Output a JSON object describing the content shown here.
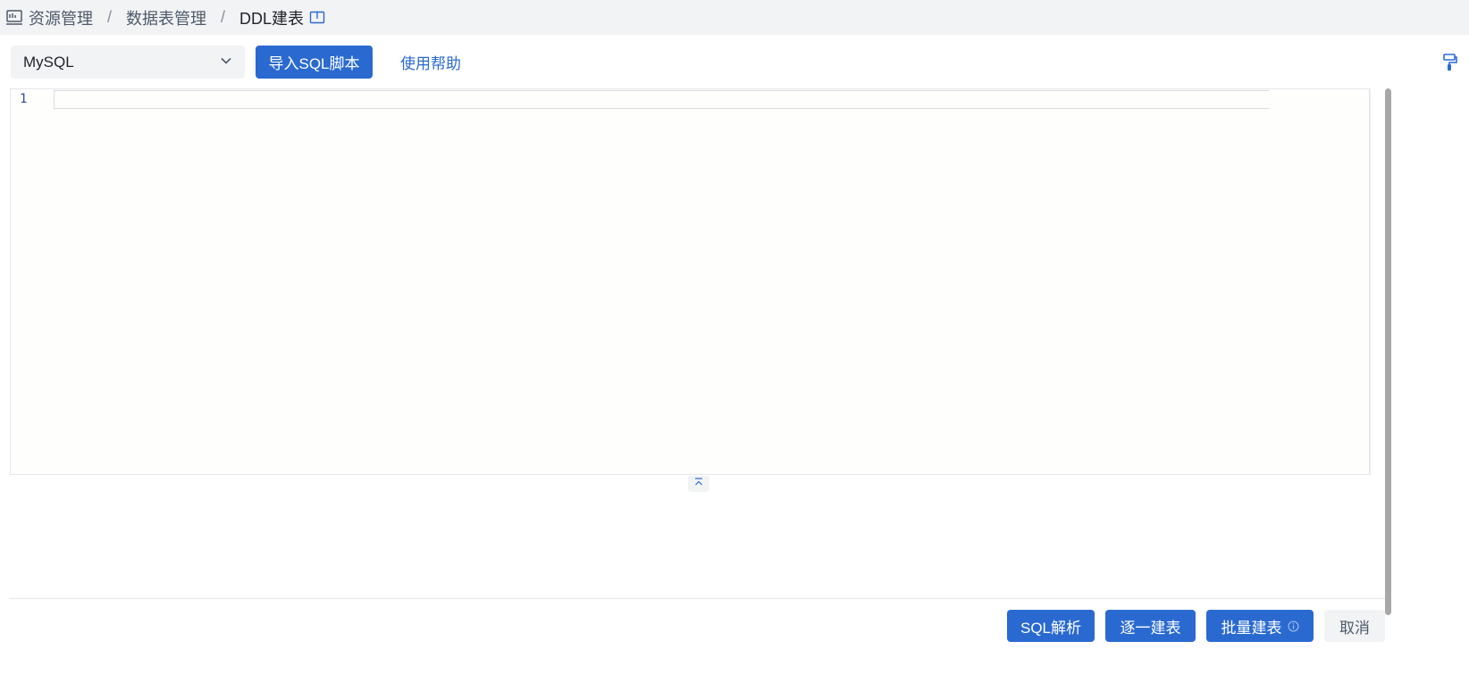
{
  "breadcrumb": {
    "items": [
      "资源管理",
      "数据表管理"
    ],
    "separator": "/",
    "current": "DDL建表"
  },
  "toolbar": {
    "db_type_selected": "MySQL",
    "import_label": "导入SQL脚本",
    "help_label": "使用帮助"
  },
  "editor": {
    "line_numbers": [
      "1"
    ],
    "content": ""
  },
  "footer": {
    "parse_label": "SQL解析",
    "one_by_one_label": "逐一建表",
    "batch_label": "批量建表",
    "cancel_label": "取消"
  },
  "colors": {
    "primary": "#2a6ad0",
    "breadcrumb_bg": "#f2f3f5",
    "editor_bg": "#fefefc"
  },
  "icons": [
    "resource-monitor-icon",
    "doc-book-icon",
    "chevron-down-icon",
    "format-brush-icon",
    "collapse-up-icon",
    "info-circle-icon"
  ]
}
